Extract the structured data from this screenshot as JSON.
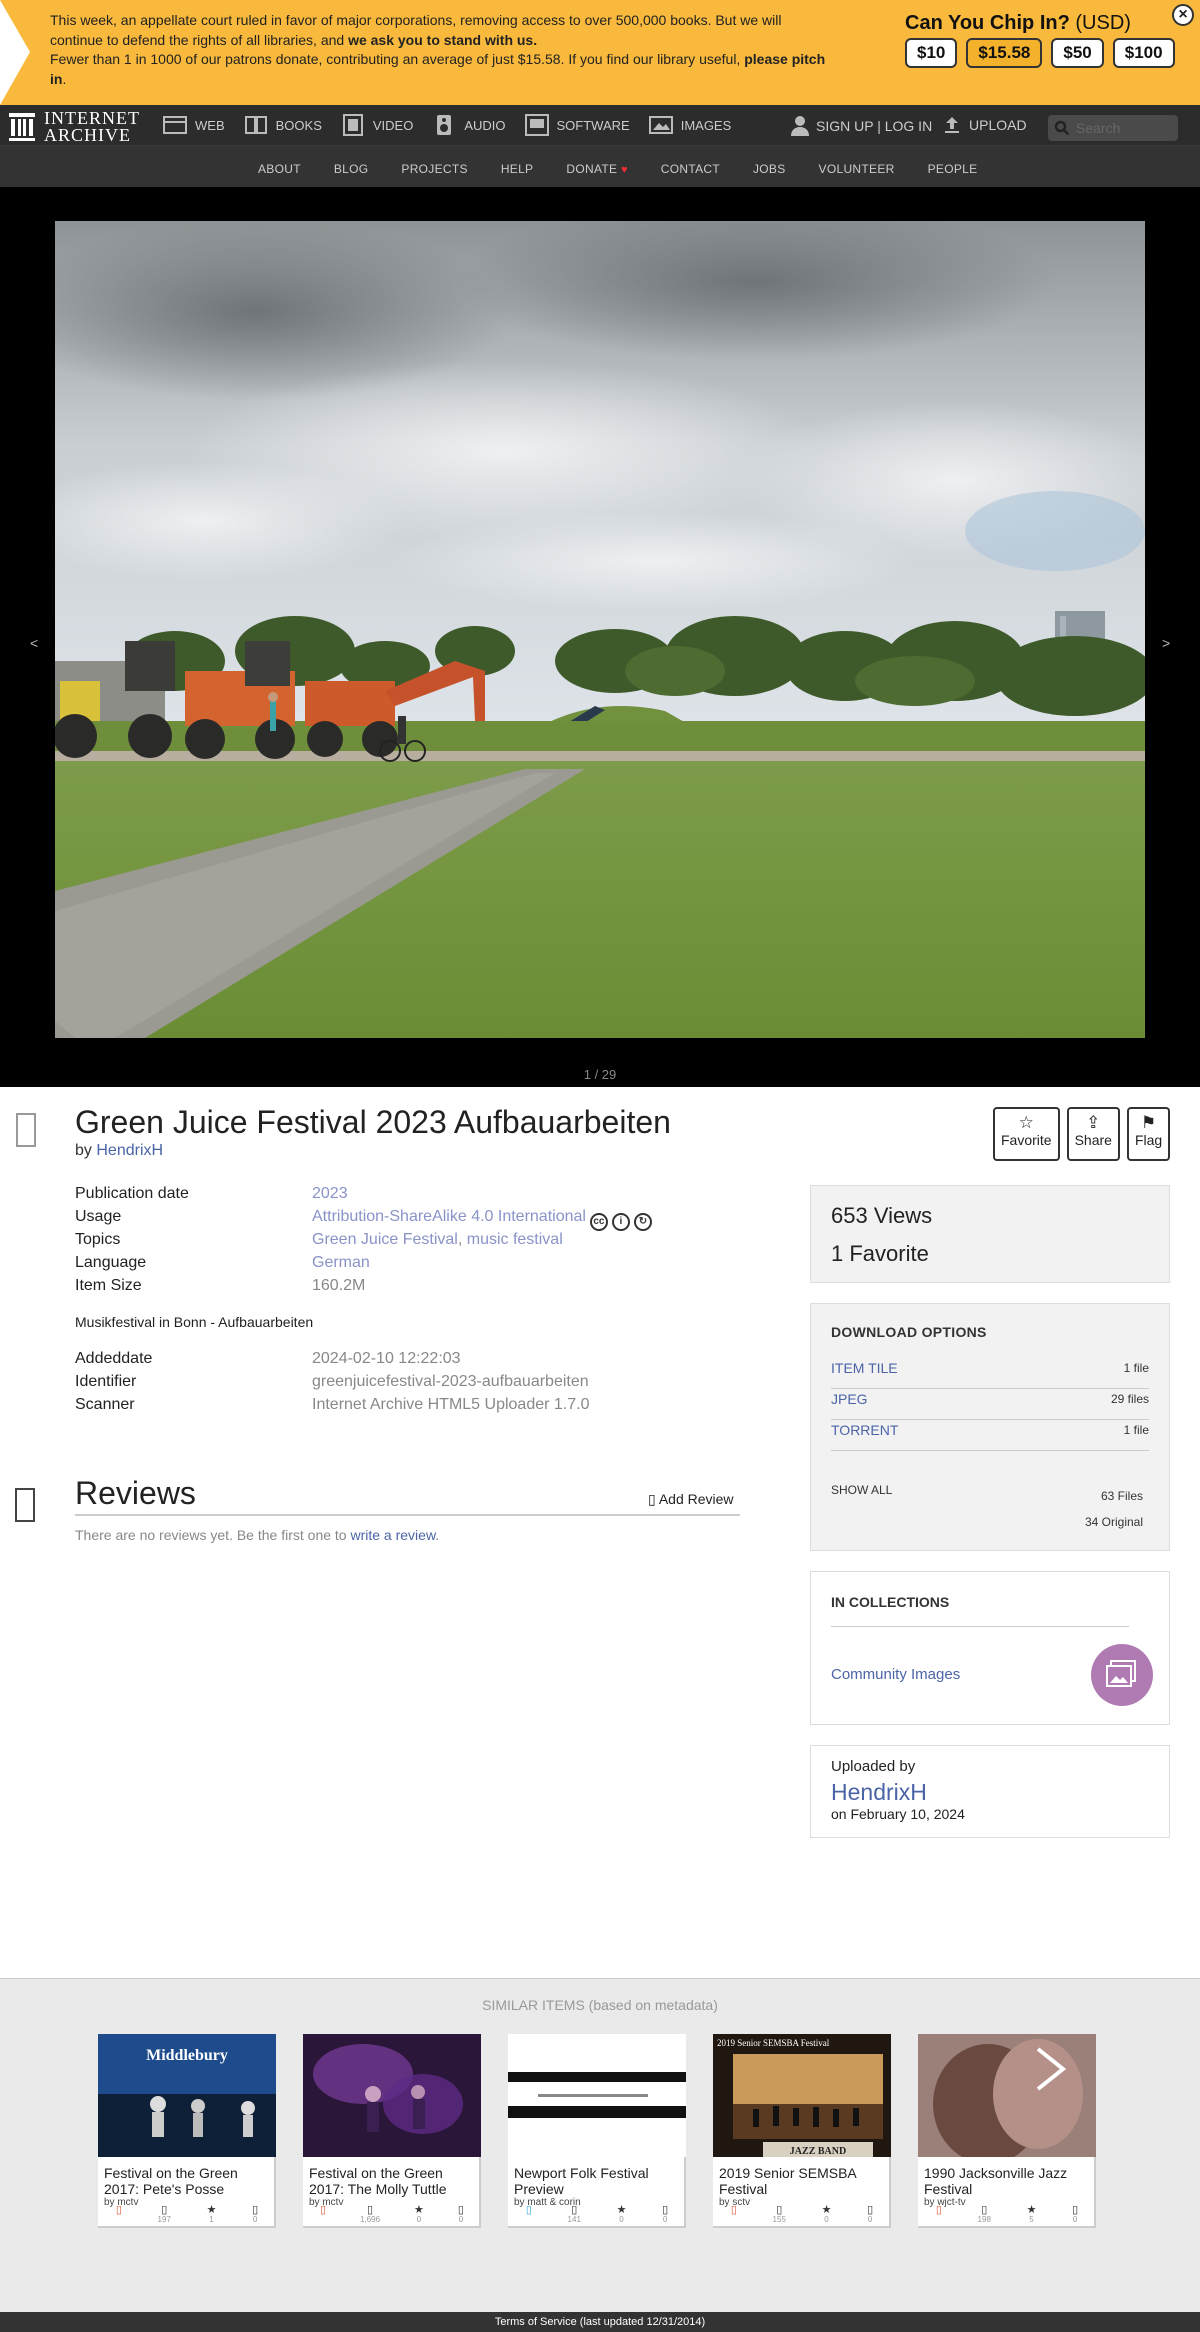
{
  "banner": {
    "line1a": "This week, an appellate court ruled in favor of major corporations, removing access to over 500,000 books. But we will continue to defend the rights of all libraries, and ",
    "line1b": "we ask you to stand with us.",
    "line2a": "Fewer than 1 in 1000 of our patrons donate, contributing an average of just $15.58. If you find our library useful, ",
    "line2b": "please pitch in",
    "line2c": ".",
    "chip_title": "Can You Chip In?",
    "chip_currency": "(USD)",
    "amounts": [
      "$10",
      "$15.58",
      "$50",
      "$100"
    ],
    "close": "×"
  },
  "topnav": {
    "logo_line1": "INTERNET",
    "logo_line2": "ARCHIVE",
    "media": [
      {
        "label": "WEB",
        "icon": "web-icon"
      },
      {
        "label": "BOOKS",
        "icon": "books-icon"
      },
      {
        "label": "VIDEO",
        "icon": "video-icon"
      },
      {
        "label": "AUDIO",
        "icon": "audio-icon"
      },
      {
        "label": "SOFTWARE",
        "icon": "software-icon"
      },
      {
        "label": "IMAGES",
        "icon": "images-icon"
      }
    ],
    "signup": "SIGN UP | LOG IN",
    "upload": "UPLOAD",
    "search_placeholder": "Search"
  },
  "subnav": [
    "ABOUT",
    "BLOG",
    "PROJECTS",
    "HELP",
    "DONATE",
    "CONTACT",
    "JOBS",
    "VOLUNTEER",
    "PEOPLE"
  ],
  "viewer": {
    "prev": "<",
    "next": ">",
    "pager": "1 / 29"
  },
  "item": {
    "title": "Green Juice Festival 2023 Aufbauarbeiten",
    "by_label": "by",
    "creator": "HendrixH",
    "actions": {
      "favorite": "Favorite",
      "share": "Share",
      "flag": "Flag"
    }
  },
  "metadata": {
    "pubdate_label": "Publication date",
    "pubdate": "2023",
    "usage_label": "Usage",
    "usage": "Attribution-ShareAlike 4.0 International",
    "topics_label": "Topics",
    "topic1": "Green Juice Festival",
    "topic_sep": ", ",
    "topic2": "music festival",
    "language_label": "Language",
    "language": "German",
    "size_label": "Item Size",
    "size": "160.2M",
    "description": "Musikfestival in Bonn - Aufbauarbeiten",
    "addeddate_label": "Addeddate",
    "addeddate": "2024-02-10 12:22:03",
    "identifier_label": "Identifier",
    "identifier": "greenjuicefestival-2023-aufbauarbeiten",
    "scanner_label": "Scanner",
    "scanner": "Internet Archive HTML5 Uploader 1.7.0"
  },
  "reviews": {
    "heading": "Reviews",
    "add": "Add Review",
    "none_text": "There are no reviews yet. Be the first one to ",
    "none_link": "write a review",
    "none_end": "."
  },
  "stats": {
    "views": "653 Views",
    "favorites": "1 Favorite"
  },
  "downloads": {
    "heading": "DOWNLOAD OPTIONS",
    "rows": [
      {
        "label": "ITEM TILE",
        "count": "1 file"
      },
      {
        "label": "JPEG",
        "count": "29 files"
      },
      {
        "label": "TORRENT",
        "count": "1 file"
      }
    ],
    "show_all": "SHOW ALL",
    "total_files": "63 Files",
    "original": "34 Original"
  },
  "collections": {
    "heading": "IN COLLECTIONS",
    "item": "Community Images"
  },
  "uploaded": {
    "label": "Uploaded by",
    "user": "HendrixH",
    "date": "on February 10, 2024"
  },
  "similar": {
    "heading": "SIMILAR ITEMS (based on metadata)",
    "items": [
      {
        "title": "Festival on the Green 2017: Pete's Posse",
        "by": "by mctv",
        "views": "197",
        "favs": "1",
        "reviews": "0",
        "banner": "Middlebury"
      },
      {
        "title": "Festival on the Green 2017: The Molly Tuttle",
        "by": "by mctv",
        "views": "1,696",
        "favs": "0",
        "reviews": "0"
      },
      {
        "title": "Newport Folk Festival Preview",
        "by": "by matt & corin",
        "views": "141",
        "favs": "0",
        "reviews": "0"
      },
      {
        "title": "2019 Senior SEMSBA Festival",
        "by": "by sctv",
        "views": "155",
        "favs": "0",
        "reviews": "0",
        "banner": "2019 Senior SEMSBA Festival",
        "banner2": "JAZZ BAND"
      },
      {
        "title": "1990 Jacksonville Jazz Festival",
        "by": "by wjct-tv",
        "views": "198",
        "favs": "5",
        "reviews": "0"
      }
    ]
  },
  "footer": "Terms of Service (last updated 12/31/2014)"
}
